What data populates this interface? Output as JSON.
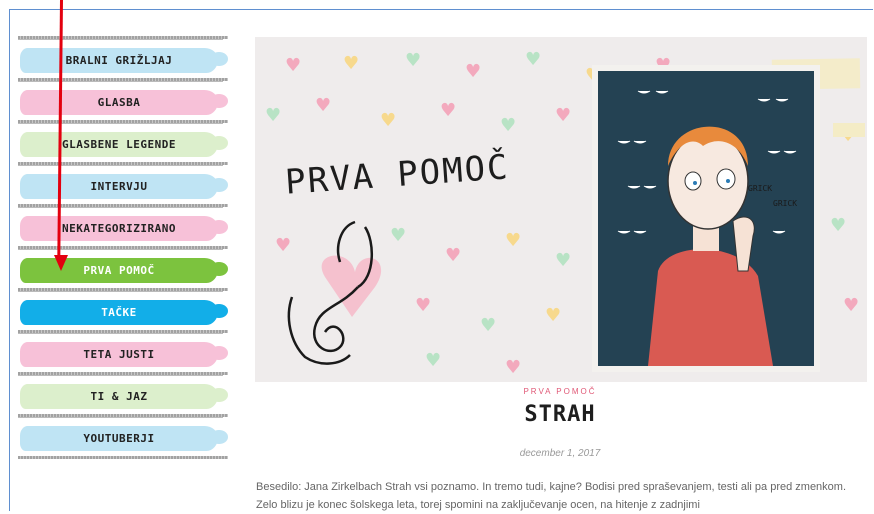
{
  "sidebar": {
    "categories": [
      {
        "label": "BRALNI GRIŽLJAJ",
        "color": "#bfe4f4"
      },
      {
        "label": "GLASBA",
        "color": "#f7c1d8"
      },
      {
        "label": "GLASBENE LEGENDE",
        "color": "#dcefcc"
      },
      {
        "label": "INTERVJU",
        "color": "#bfe4f4"
      },
      {
        "label": "NEKATEGORIZIRANO",
        "color": "#f7c1d8"
      },
      {
        "label": "PRVA POMOČ",
        "color": "#7cc33e",
        "active": true
      },
      {
        "label": "TAČKE",
        "color": "#12aee8"
      },
      {
        "label": "TETA JUSTI",
        "color": "#f7c1d8"
      },
      {
        "label": "TI & JAZ",
        "color": "#dcefcc"
      },
      {
        "label": "YOUTUBERJI",
        "color": "#bfe4f4"
      }
    ]
  },
  "hero": {
    "title": "PRVA POMOČ",
    "illustration_text": [
      "GRICK",
      "GRICK"
    ]
  },
  "post": {
    "category": "PRVA POMOČ",
    "title": "STRAH",
    "date": "december 1, 2017",
    "excerpt": "Besedilo: Jana Zirkelbach Strah vsi poznamo. In tremo tudi, kajne? Bodisi pred spraševanjem, testi ali pa pred zmenkom. Zelo blizu je konec šolskega leta, torej spomini na zaključevanje ocen, na hitenje z zadnjimi"
  },
  "colors": {
    "frame": "#5f8fd0",
    "annotation_arrow": "#e3000f",
    "accent_pink": "#e05876"
  }
}
